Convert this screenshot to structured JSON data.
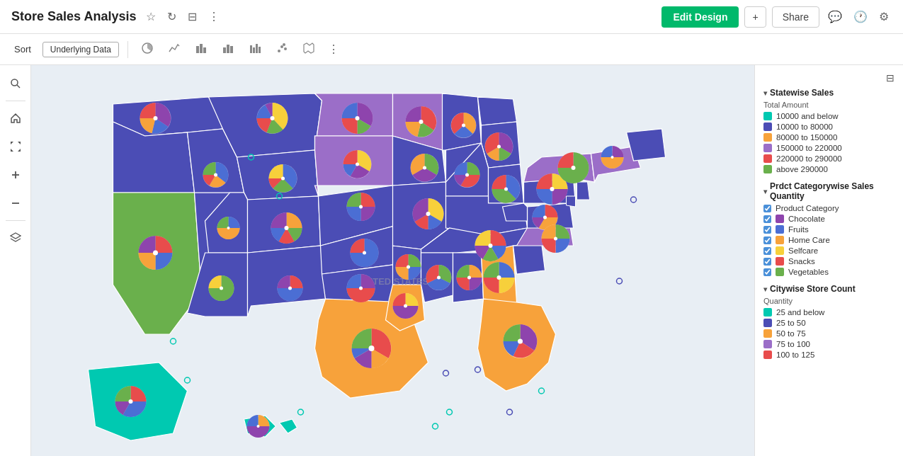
{
  "header": {
    "title": "Store Sales Analysis",
    "edit_label": "Edit Design",
    "share_label": "Share",
    "plus_label": "+",
    "icons": [
      "star-icon",
      "refresh-icon",
      "layout-icon",
      "more-icon"
    ]
  },
  "toolbar": {
    "sort_label": "Sort",
    "underlying_label": "Underlying Data",
    "more_label": "⋮",
    "chart_icons": [
      "circle-chart",
      "line-chart",
      "bar-chart",
      "col-chart",
      "hist-chart",
      "scatter-chart",
      "map-chart"
    ]
  },
  "sidebar_left": {
    "icons": [
      "search-icon",
      "home-icon",
      "expand-icon",
      "plus-icon",
      "minus-icon",
      "layers-icon"
    ]
  },
  "legend": {
    "panel_toggle": "⊟",
    "statewise": {
      "header": "Statewise Sales",
      "sub_label": "Total Amount",
      "items": [
        {
          "label": "10000 and below",
          "color": "#00c9b1"
        },
        {
          "label": "10000 to 80000",
          "color": "#4b4db5"
        },
        {
          "label": "80000 to 150000",
          "color": "#f7a23b"
        },
        {
          "label": "150000 to 220000",
          "color": "#9b6ec8"
        },
        {
          "label": "220000 to 290000",
          "color": "#e84c4c"
        },
        {
          "label": "above 290000",
          "color": "#6ab04c"
        }
      ]
    },
    "product_category": {
      "header": "Prdct Categorywise Sales Quantity",
      "sub_label": "Product Category",
      "items": [
        {
          "label": "Chocolate",
          "color": "#8e44ad",
          "checked": true
        },
        {
          "label": "Fruits",
          "color": "#4b6ed4",
          "checked": true
        },
        {
          "label": "Home Care",
          "color": "#f7a23b",
          "checked": true
        },
        {
          "label": "Selfcare",
          "color": "#f7d03b",
          "checked": true
        },
        {
          "label": "Snacks",
          "color": "#e84c4c",
          "checked": true
        },
        {
          "label": "Vegetables",
          "color": "#6ab04c",
          "checked": true
        }
      ]
    },
    "citywise": {
      "header": "Citywise Store Count",
      "sub_label": "Quantity",
      "items": [
        {
          "label": "25 and below",
          "color": "#00c9b1"
        },
        {
          "label": "25 to 50",
          "color": "#4b4db5"
        },
        {
          "label": "50 to 75",
          "color": "#f7a23b"
        },
        {
          "label": "75 to 100",
          "color": "#9b6ec8"
        },
        {
          "label": "100 to 125",
          "color": "#e84c4c"
        }
      ]
    }
  },
  "map": {
    "label": "UNITED STATES"
  }
}
